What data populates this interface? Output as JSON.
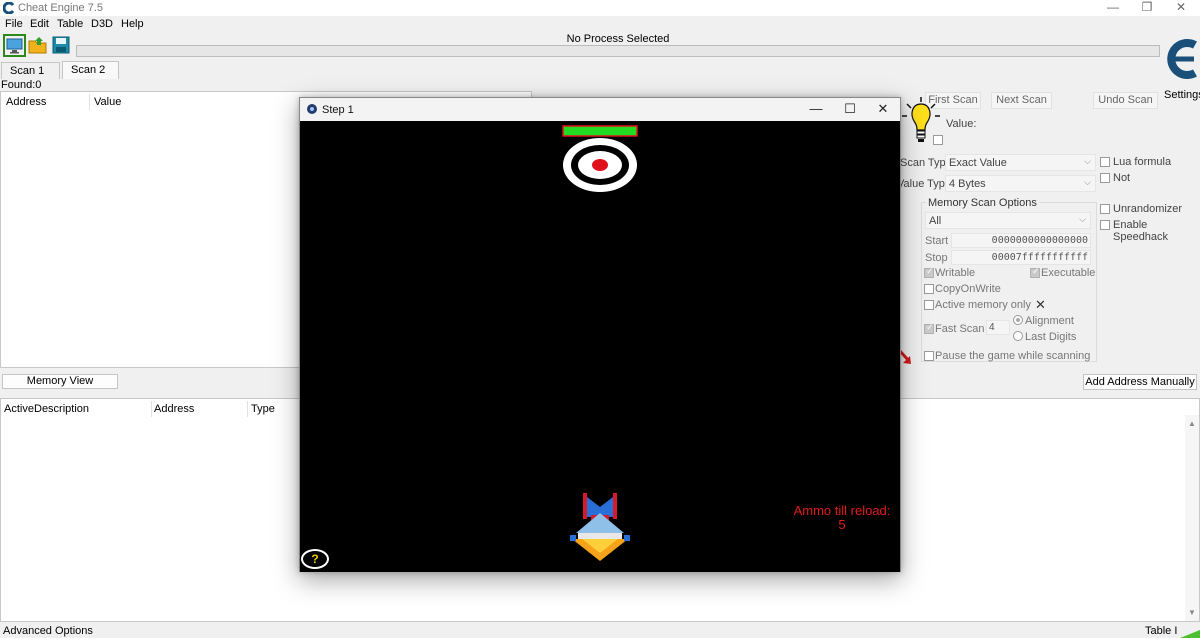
{
  "window": {
    "title": "Cheat Engine 7.5"
  },
  "menu": [
    "File",
    "Edit",
    "Table",
    "D3D",
    "Help"
  ],
  "toolbar": {
    "process_label": "No Process Selected",
    "settings_label": "Settings"
  },
  "tabs": [
    "Scan 1",
    "Scan 2"
  ],
  "found": "Found:0",
  "found_list": {
    "columns": [
      "Address",
      "Value"
    ]
  },
  "buttons": {
    "first_scan": "First Scan",
    "next_scan": "Next Scan",
    "undo_scan": "Undo Scan",
    "memory_view": "Memory View",
    "add_address": "Add Address Manually"
  },
  "scan_options": {
    "value_label": "Value:",
    "scan_type_label": "Scan Type",
    "scan_type_value": "Exact Value",
    "value_type_label": "Value Type",
    "value_type_value": "4 Bytes",
    "lua_formula": "Lua formula",
    "not": "Not",
    "memory_group_title": "Memory Scan Options",
    "region_value": "All",
    "start_label": "Start",
    "start_value": "0000000000000000",
    "stop_label": "Stop",
    "stop_value": "00007fffffffffff",
    "writable": "Writable",
    "executable": "Executable",
    "copy_on_write": "CopyOnWrite",
    "active_memory_only": "Active memory only",
    "fast_scan": "Fast Scan",
    "fast_scan_value": "4",
    "alignment": "Alignment",
    "last_digits": "Last Digits",
    "pause_game": "Pause the game while scanning",
    "unrandomizer": "Unrandomizer",
    "enable_speedhack": "Enable Speedhack"
  },
  "address_table": {
    "columns": [
      "Active",
      "Description",
      "Address",
      "Type"
    ]
  },
  "footer": {
    "advanced": "Advanced Options",
    "table": "Table I"
  },
  "game_window": {
    "title": "Step 1",
    "ammo_label": "Ammo till reload:",
    "ammo_value": "5",
    "help": "?"
  },
  "colors": {
    "accent_green": "#2b8a19",
    "ammo_red": "#e21b1b",
    "target_red": "#e0101a",
    "health_green": "#22dd22"
  }
}
